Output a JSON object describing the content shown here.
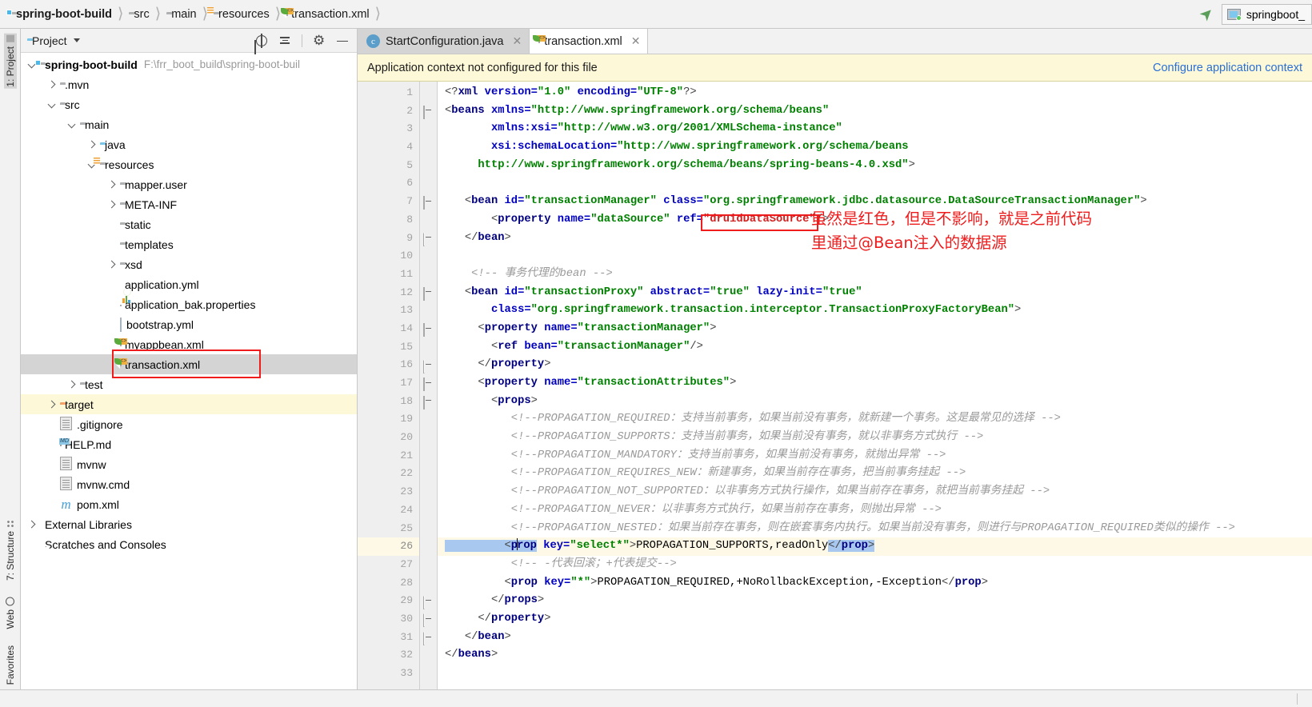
{
  "breadcrumb": {
    "items": [
      {
        "label": "spring-boot-build",
        "icon": "module-folder-icon",
        "bold": true
      },
      {
        "label": "src",
        "icon": "folder-icon",
        "bold": false
      },
      {
        "label": "main",
        "icon": "folder-icon",
        "bold": false
      },
      {
        "label": "resources",
        "icon": "resources-folder-icon",
        "bold": false
      },
      {
        "label": "transaction.xml",
        "icon": "xml-file-icon",
        "bold": false
      }
    ]
  },
  "titlebar": {
    "run_config_label": "springboot_",
    "jump_icon": "arrow-up-left-icon",
    "run_config_icon": "application-window-icon"
  },
  "toolstrip": {
    "top": [
      {
        "label": "1: Project",
        "icon": "project-folder-icon",
        "active": true
      }
    ],
    "bottom": [
      {
        "label": "7: Structure",
        "icon": "structure-icon"
      },
      {
        "label": "Web",
        "icon": "globe-icon"
      },
      {
        "label": "Favorites",
        "icon": "favorites-icon"
      }
    ]
  },
  "project_panel": {
    "title": "Project",
    "dropdown_icon": "chevron-down-icon",
    "toolbar_icons": [
      "locate-target-icon",
      "collapse-all-icon",
      "gear-icon",
      "hide-icon"
    ],
    "tree": [
      {
        "depth": 0,
        "twisty": "down",
        "icon": "module-folder-icon",
        "label": "spring-boot-build",
        "bold": true,
        "path": "F:\\frr_boot_build\\spring-boot-buil",
        "state": "normal"
      },
      {
        "depth": 1,
        "twisty": "right",
        "icon": "folder-icon",
        "label": ".mvn",
        "state": "normal"
      },
      {
        "depth": 1,
        "twisty": "down",
        "icon": "folder-icon",
        "label": "src",
        "state": "normal"
      },
      {
        "depth": 2,
        "twisty": "down",
        "icon": "folder-icon",
        "label": "main",
        "state": "normal"
      },
      {
        "depth": 3,
        "twisty": "right",
        "icon": "source-folder-icon",
        "label": "java",
        "state": "normal"
      },
      {
        "depth": 3,
        "twisty": "down",
        "icon": "resources-folder-icon",
        "label": "resources",
        "state": "normal"
      },
      {
        "depth": 4,
        "twisty": "right",
        "icon": "package-folder-icon",
        "label": "mapper.user",
        "state": "normal"
      },
      {
        "depth": 4,
        "twisty": "right",
        "icon": "package-folder-icon",
        "label": "META-INF",
        "state": "normal"
      },
      {
        "depth": 4,
        "twisty": "none",
        "icon": "package-folder-icon",
        "label": "static",
        "state": "normal"
      },
      {
        "depth": 4,
        "twisty": "none",
        "icon": "package-folder-icon",
        "label": "templates",
        "state": "normal"
      },
      {
        "depth": 4,
        "twisty": "right",
        "icon": "package-folder-icon",
        "label": "xsd",
        "state": "normal"
      },
      {
        "depth": 4,
        "twisty": "none",
        "icon": "spring-yml-icon",
        "label": "application.yml",
        "state": "normal"
      },
      {
        "depth": 4,
        "twisty": "none",
        "icon": "properties-icon",
        "label": "application_bak.properties",
        "state": "normal"
      },
      {
        "depth": 4,
        "twisty": "none",
        "icon": "yml-grid-icon",
        "label": "bootstrap.yml",
        "state": "normal"
      },
      {
        "depth": 4,
        "twisty": "none",
        "icon": "spring-xml-icon",
        "label": "myappbean.xml",
        "state": "normal"
      },
      {
        "depth": 4,
        "twisty": "none",
        "icon": "spring-xml-icon",
        "label": "transaction.xml",
        "state": "selected"
      },
      {
        "depth": 2,
        "twisty": "right",
        "icon": "folder-icon",
        "label": "test",
        "state": "normal"
      },
      {
        "depth": 1,
        "twisty": "right",
        "icon": "target-folder-icon",
        "label": "target",
        "state": "highlighted"
      },
      {
        "depth": 1,
        "twisty": "none",
        "icon": "text-file-icon",
        "label": ".gitignore",
        "state": "normal"
      },
      {
        "depth": 1,
        "twisty": "none",
        "icon": "markdown-icon",
        "label": "HELP.md",
        "state": "normal"
      },
      {
        "depth": 1,
        "twisty": "none",
        "icon": "text-file-icon",
        "label": "mvnw",
        "state": "normal"
      },
      {
        "depth": 1,
        "twisty": "none",
        "icon": "text-file-icon",
        "label": "mvnw.cmd",
        "state": "normal"
      },
      {
        "depth": 1,
        "twisty": "none",
        "icon": "maven-icon",
        "label": "pom.xml",
        "state": "normal"
      },
      {
        "depth": 0,
        "twisty": "right",
        "icon": "libraries-icon",
        "label": "External Libraries",
        "state": "normal"
      },
      {
        "depth": 0,
        "twisty": "none",
        "icon": "scratches-icon",
        "label": "Scratches and Consoles",
        "state": "normal"
      }
    ]
  },
  "editor": {
    "tabs": [
      {
        "label": "StartConfiguration.java",
        "icon": "java-class-icon",
        "active": false,
        "close_icon": "close-icon"
      },
      {
        "label": "transaction.xml",
        "icon": "spring-xml-icon",
        "active": true,
        "close_icon": "close-icon"
      }
    ],
    "notice": {
      "message": "Application context not configured for this file",
      "link": "Configure application context"
    },
    "current_line": 26,
    "line_numbers": [
      1,
      2,
      3,
      4,
      5,
      6,
      7,
      8,
      9,
      10,
      11,
      12,
      13,
      14,
      15,
      16,
      17,
      18,
      19,
      20,
      21,
      22,
      23,
      24,
      25,
      26,
      27,
      28,
      29,
      30,
      31,
      32,
      33
    ],
    "gutter_bulb_line": 26,
    "annotation": {
      "text": "虽然是红色，但是不影响，就是之前代码\n里通过@Bean注入的数据源",
      "color": "#ee1c1c"
    },
    "red_highlight_token": "druidDataSource"
  },
  "code_lines": [
    {
      "n": 1,
      "segs": [
        {
          "t": "<?",
          "c": "punc"
        },
        {
          "t": "xml",
          "c": "tagc"
        },
        {
          "t": " version=",
          "c": "attr"
        },
        {
          "t": "\"1.0\"",
          "c": "val"
        },
        {
          "t": " encoding=",
          "c": "attr"
        },
        {
          "t": "\"UTF-8\"",
          "c": "val"
        },
        {
          "t": "?>",
          "c": "punc"
        }
      ]
    },
    {
      "n": 2,
      "segs": [
        {
          "t": "<",
          "c": "punc"
        },
        {
          "t": "beans",
          "c": "tagc"
        },
        {
          "t": " xmlns=",
          "c": "attr"
        },
        {
          "t": "\"http://www.springframework.org/schema/beans\"",
          "c": "val"
        }
      ]
    },
    {
      "n": 3,
      "segs": [
        {
          "t": "       xmlns:xsi=",
          "c": "attr"
        },
        {
          "t": "\"http://www.w3.org/2001/XMLSchema-instance\"",
          "c": "val"
        }
      ]
    },
    {
      "n": 4,
      "segs": [
        {
          "t": "       xsi:schemaLocation=",
          "c": "attr"
        },
        {
          "t": "\"http://www.springframework.org/schema/beans",
          "c": "val"
        }
      ]
    },
    {
      "n": 5,
      "segs": [
        {
          "t": "     http://www.springframework.org/schema/beans/spring-beans-4.0.xsd\"",
          "c": "val"
        },
        {
          "t": ">",
          "c": "punc"
        }
      ]
    },
    {
      "n": 6,
      "segs": []
    },
    {
      "n": 7,
      "segs": [
        {
          "t": "   <",
          "c": "punc"
        },
        {
          "t": "bean",
          "c": "tagc"
        },
        {
          "t": " id=",
          "c": "attr"
        },
        {
          "t": "\"transactionManager\"",
          "c": "val"
        },
        {
          "t": " class=",
          "c": "attr"
        },
        {
          "t": "\"org.springframework.jdbc.datasource.DataSourceTransactionManager\"",
          "c": "val"
        },
        {
          "t": ">",
          "c": "punc"
        }
      ]
    },
    {
      "n": 8,
      "segs": [
        {
          "t": "       <",
          "c": "punc"
        },
        {
          "t": "property",
          "c": "tagc"
        },
        {
          "t": " name=",
          "c": "attr"
        },
        {
          "t": "\"dataSource\"",
          "c": "val"
        },
        {
          "t": " ref=",
          "c": "attr"
        },
        {
          "t": "\"druidDataSource\"",
          "c": "redt"
        },
        {
          "t": "/>",
          "c": "punc"
        }
      ]
    },
    {
      "n": 9,
      "segs": [
        {
          "t": "   </",
          "c": "punc"
        },
        {
          "t": "bean",
          "c": "tagc"
        },
        {
          "t": ">",
          "c": "punc"
        }
      ]
    },
    {
      "n": 10,
      "segs": []
    },
    {
      "n": 11,
      "segs": [
        {
          "t": "    <!-- 事务代理的bean -->",
          "c": "cmt"
        }
      ]
    },
    {
      "n": 12,
      "segs": [
        {
          "t": "   <",
          "c": "punc"
        },
        {
          "t": "bean",
          "c": "tagc"
        },
        {
          "t": " id=",
          "c": "attr"
        },
        {
          "t": "\"transactionProxy\"",
          "c": "val"
        },
        {
          "t": " abstract=",
          "c": "attr"
        },
        {
          "t": "\"true\"",
          "c": "val"
        },
        {
          "t": " lazy-init=",
          "c": "attr"
        },
        {
          "t": "\"true\"",
          "c": "val"
        }
      ]
    },
    {
      "n": 13,
      "segs": [
        {
          "t": "       class=",
          "c": "attr"
        },
        {
          "t": "\"org.springframework.transaction.interceptor.TransactionProxyFactoryBean\"",
          "c": "val"
        },
        {
          "t": ">",
          "c": "punc"
        }
      ]
    },
    {
      "n": 14,
      "segs": [
        {
          "t": "     <",
          "c": "punc"
        },
        {
          "t": "property",
          "c": "tagc"
        },
        {
          "t": " name=",
          "c": "attr"
        },
        {
          "t": "\"transactionManager\"",
          "c": "val"
        },
        {
          "t": ">",
          "c": "punc"
        }
      ]
    },
    {
      "n": 15,
      "segs": [
        {
          "t": "       <",
          "c": "punc"
        },
        {
          "t": "ref",
          "c": "tagc"
        },
        {
          "t": " bean=",
          "c": "attr"
        },
        {
          "t": "\"transactionManager\"",
          "c": "val"
        },
        {
          "t": "/>",
          "c": "punc"
        }
      ]
    },
    {
      "n": 16,
      "segs": [
        {
          "t": "     </",
          "c": "punc"
        },
        {
          "t": "property",
          "c": "tagc"
        },
        {
          "t": ">",
          "c": "punc"
        }
      ]
    },
    {
      "n": 17,
      "segs": [
        {
          "t": "     <",
          "c": "punc"
        },
        {
          "t": "property",
          "c": "tagc"
        },
        {
          "t": " name=",
          "c": "attr"
        },
        {
          "t": "\"transactionAttributes\"",
          "c": "val"
        },
        {
          "t": ">",
          "c": "punc"
        }
      ]
    },
    {
      "n": 18,
      "segs": [
        {
          "t": "       <",
          "c": "punc"
        },
        {
          "t": "props",
          "c": "tagc"
        },
        {
          "t": ">",
          "c": "punc"
        }
      ]
    },
    {
      "n": 19,
      "segs": [
        {
          "t": "          <!--PROPAGATION_REQUIRED：支持当前事务，如果当前没有事务，就新建一个事务。这是最常见的选择 -->",
          "c": "cmt"
        }
      ]
    },
    {
      "n": 20,
      "segs": [
        {
          "t": "          <!--PROPAGATION_SUPPORTS：支持当前事务，如果当前没有事务，就以非事务方式执行 -->",
          "c": "cmt"
        }
      ]
    },
    {
      "n": 21,
      "segs": [
        {
          "t": "          <!--PROPAGATION_MANDATORY：支持当前事务，如果当前没有事务，就抛出异常 -->",
          "c": "cmt"
        }
      ]
    },
    {
      "n": 22,
      "segs": [
        {
          "t": "          <!--PROPAGATION_REQUIRES_NEW：新建事务，如果当前存在事务，把当前事务挂起 -->",
          "c": "cmt"
        }
      ]
    },
    {
      "n": 23,
      "segs": [
        {
          "t": "          <!--PROPAGATION_NOT_SUPPORTED：以非事务方式执行操作，如果当前存在事务，就把当前事务挂起 -->",
          "c": "cmt"
        }
      ]
    },
    {
      "n": 24,
      "segs": [
        {
          "t": "          <!--PROPAGATION_NEVER：以非事务方式执行，如果当前存在事务，则抛出异常 -->",
          "c": "cmt"
        }
      ]
    },
    {
      "n": 25,
      "segs": [
        {
          "t": "          <!--PROPAGATION_NESTED：如果当前存在事务，则在嵌套事务内执行。如果当前没有事务，则进行与PROPAGATION_REQUIRED类似的操作 -->",
          "c": "cmt"
        }
      ]
    },
    {
      "n": 26,
      "segs": [
        {
          "t": "         <",
          "c": "selhl-punc"
        },
        {
          "t": "prop",
          "c": "selhl-tag-caret"
        },
        {
          "t": " key=",
          "c": "attr"
        },
        {
          "t": "\"select*\"",
          "c": "val"
        },
        {
          "t": ">",
          "c": "punc"
        },
        {
          "t": "PROPAGATION_SUPPORTS,readOnly",
          "c": "txt"
        },
        {
          "t": "</",
          "c": "selhl-punc"
        },
        {
          "t": "prop",
          "c": "selhl-tag"
        },
        {
          "t": ">",
          "c": "selhl-punc"
        }
      ]
    },
    {
      "n": 27,
      "segs": [
        {
          "t": "          <!-- -代表回滚；+代表提交-->",
          "c": "cmt"
        }
      ]
    },
    {
      "n": 28,
      "segs": [
        {
          "t": "         <",
          "c": "punc"
        },
        {
          "t": "prop",
          "c": "tagc"
        },
        {
          "t": " key=",
          "c": "attr"
        },
        {
          "t": "\"*\"",
          "c": "val"
        },
        {
          "t": ">",
          "c": "punc"
        },
        {
          "t": "PROPAGATION_REQUIRED,+NoRollbackException,-Exception",
          "c": "txt"
        },
        {
          "t": "</",
          "c": "punc"
        },
        {
          "t": "prop",
          "c": "tagc"
        },
        {
          "t": ">",
          "c": "punc"
        }
      ]
    },
    {
      "n": 29,
      "segs": [
        {
          "t": "       </",
          "c": "punc"
        },
        {
          "t": "props",
          "c": "tagc"
        },
        {
          "t": ">",
          "c": "punc"
        }
      ]
    },
    {
      "n": 30,
      "segs": [
        {
          "t": "     </",
          "c": "punc"
        },
        {
          "t": "property",
          "c": "tagc"
        },
        {
          "t": ">",
          "c": "punc"
        }
      ]
    },
    {
      "n": 31,
      "segs": [
        {
          "t": "   </",
          "c": "punc"
        },
        {
          "t": "bean",
          "c": "tagc"
        },
        {
          "t": ">",
          "c": "punc"
        }
      ]
    },
    {
      "n": 32,
      "segs": [
        {
          "t": "</",
          "c": "punc"
        },
        {
          "t": "beans",
          "c": "tagc"
        },
        {
          "t": ">",
          "c": "punc"
        }
      ]
    },
    {
      "n": 33,
      "segs": []
    }
  ],
  "fold_markers": [
    {
      "line": 2,
      "type": "open"
    },
    {
      "line": 7,
      "type": "open"
    },
    {
      "line": 9,
      "type": "end"
    },
    {
      "line": 12,
      "type": "open"
    },
    {
      "line": 14,
      "type": "open"
    },
    {
      "line": 16,
      "type": "end"
    },
    {
      "line": 17,
      "type": "open"
    },
    {
      "line": 18,
      "type": "open"
    },
    {
      "line": 29,
      "type": "end"
    },
    {
      "line": 30,
      "type": "end"
    },
    {
      "line": 31,
      "type": "end"
    }
  ],
  "status_bar": {
    "right_text": ""
  }
}
